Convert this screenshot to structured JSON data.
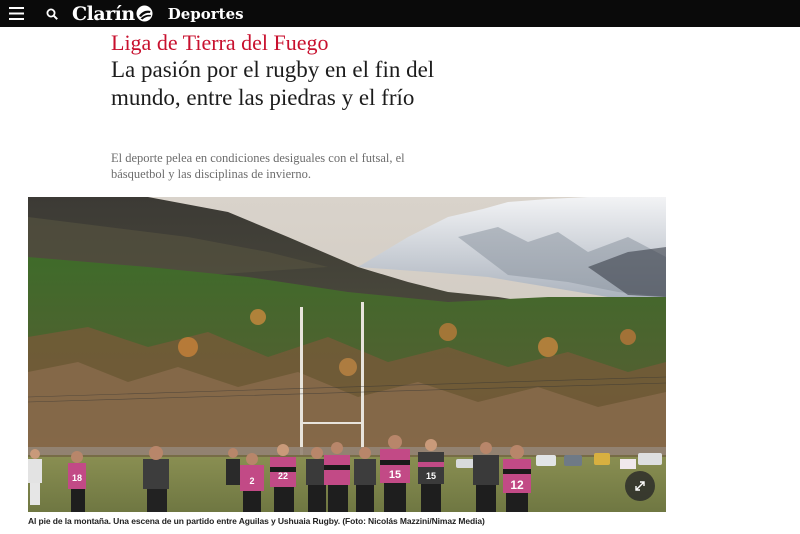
{
  "header": {
    "logo_text": "Clarín",
    "section": "Deportes",
    "colors": {
      "background": "#0a0a0a",
      "text": "#ffffff"
    },
    "icons": [
      "menu-icon",
      "search-icon",
      "clarin-logo-mark"
    ]
  },
  "article": {
    "kicker": "Liga de Tierra del Fuego",
    "headline": "La pasión por el rugby en el fin del mundo, entre las piedras y el frío",
    "dek": "El deporte pelea en condiciones desiguales con el futsal, el básquetbol y las disciplinas de invierno.",
    "kicker_color": "#c8102e",
    "photo_caption": "Al pie de la montaña. Una escena de un partido entre Aguilas y Ushuaia Rugby. (Foto: Nicolás Mazzini/Nimaz Media)",
    "player_numbers": [
      "18",
      "2",
      "22",
      "15",
      "15",
      "12"
    ]
  }
}
